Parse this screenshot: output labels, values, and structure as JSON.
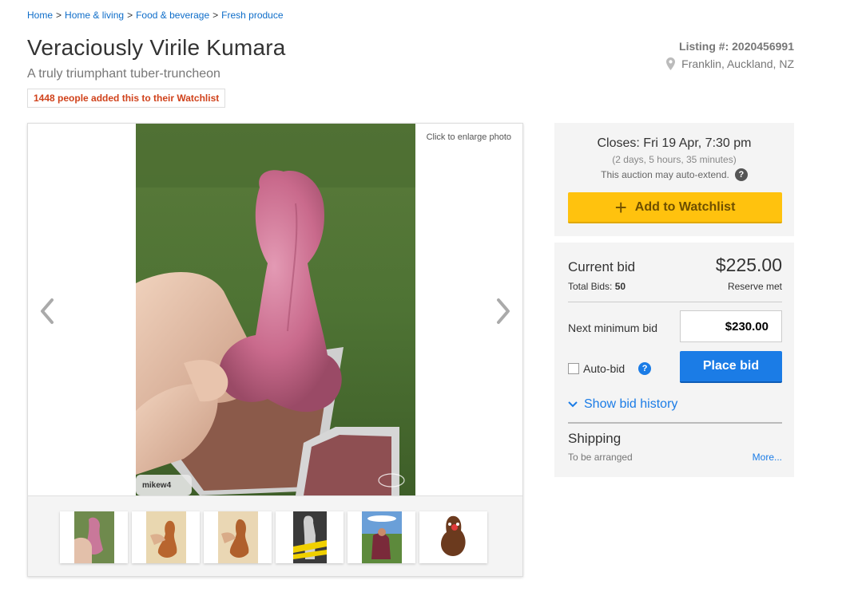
{
  "breadcrumb": {
    "items": [
      "Home",
      "Home & living",
      "Food & beverage",
      "Fresh produce"
    ],
    "separator": ">"
  },
  "listing": {
    "title": "Veraciously Virile Kumara",
    "subtitle": "A truly triumphant tuber-truncheon",
    "watchlist_badge": "1448 people added this to their Watchlist",
    "listing_number": "Listing #: 2020456991",
    "location": "Franklin, Auckland, NZ"
  },
  "gallery": {
    "enlarge_text": "Click to enlarge photo",
    "photographer_tag": "mikew4",
    "thumbnail_count": 6
  },
  "auction": {
    "closes": "Closes: Fri 19 Apr, 7:30 pm",
    "closes_relative": "(2 days, 5 hours, 35 minutes)",
    "auto_extend": "This auction may auto-extend.",
    "watchlist_button": "Add to Watchlist"
  },
  "bidding": {
    "current_bid_label": "Current bid",
    "current_bid_value": "$225.00",
    "total_bids_label": "Total Bids:",
    "total_bids_value": "50",
    "reserve_status": "Reserve met",
    "next_min_label": "Next minimum bid",
    "next_min_value": "$230.00",
    "auto_bid_label": "Auto-bid",
    "place_bid_button": "Place bid",
    "show_history": "Show bid history"
  },
  "shipping": {
    "title": "Shipping",
    "value": "To be arranged",
    "more_link": "More..."
  },
  "colors": {
    "link_blue": "#0e6dc9",
    "watch_badge_red": "#d0421b",
    "watchlist_yellow": "#ffc20e",
    "bid_blue": "#1b7ce6"
  }
}
